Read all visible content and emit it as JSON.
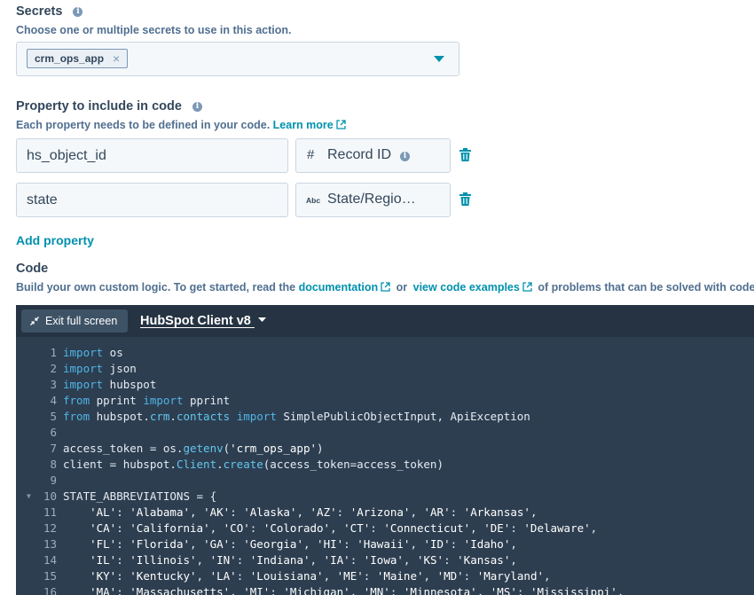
{
  "secrets": {
    "label": "Secrets",
    "info": "i",
    "help": "Choose one or multiple secrets to use in this action.",
    "selected_tag": "crm_ops_app",
    "tag_remove": "×"
  },
  "properties": {
    "label": "Property to include in code",
    "info": "i",
    "help": "Each property needs to be defined in your code.",
    "learn_more": "Learn more",
    "rows": [
      {
        "name": "hs_object_id",
        "type_icon": "#",
        "type_label": "Record ID",
        "type_info": "i"
      },
      {
        "name": "state",
        "type_icon": "Abc",
        "type_label": "State/Regio…"
      }
    ],
    "add_label": "Add property"
  },
  "code_section": {
    "label": "Code",
    "help_prefix": "Build your own custom logic. To get started, read the",
    "documentation_link": "documentation",
    "or_text": "or",
    "examples_link": "view code examples",
    "help_suffix": "of problems that can be solved with code"
  },
  "editor": {
    "exit_button": "Exit full screen",
    "client_select": "HubSpot Client v8",
    "lines": [
      {
        "n": "1",
        "text": "import os"
      },
      {
        "n": "2",
        "text": "import json"
      },
      {
        "n": "3",
        "text": "import hubspot"
      },
      {
        "n": "4",
        "text": "from pprint import pprint"
      },
      {
        "n": "5",
        "text": "from hubspot.crm.contacts import SimplePublicObjectInput, ApiException"
      },
      {
        "n": "6",
        "text": ""
      },
      {
        "n": "7",
        "text": "access_token = os.getenv('crm_ops_app')"
      },
      {
        "n": "8",
        "text": "client = hubspot.Client.create(access_token=access_token)"
      },
      {
        "n": "9",
        "text": ""
      },
      {
        "n": "10",
        "text": "STATE_ABBREVIATIONS = {",
        "fold": true
      },
      {
        "n": "11",
        "text": "    'AL': 'Alabama', 'AK': 'Alaska', 'AZ': 'Arizona', 'AR': 'Arkansas',"
      },
      {
        "n": "12",
        "text": "    'CA': 'California', 'CO': 'Colorado', 'CT': 'Connecticut', 'DE': 'Delaware',"
      },
      {
        "n": "13",
        "text": "    'FL': 'Florida', 'GA': 'Georgia', 'HI': 'Hawaii', 'ID': 'Idaho',"
      },
      {
        "n": "14",
        "text": "    'IL': 'Illinois', 'IN': 'Indiana', 'IA': 'Iowa', 'KS': 'Kansas',"
      },
      {
        "n": "15",
        "text": "    'KY': 'Kentucky', 'LA': 'Louisiana', 'ME': 'Maine', 'MD': 'Maryland',"
      },
      {
        "n": "16",
        "text": "    'MA': 'Massachusetts', 'MI': 'Michigan', 'MN': 'Minnesota', 'MS': 'Mississippi',"
      }
    ]
  }
}
